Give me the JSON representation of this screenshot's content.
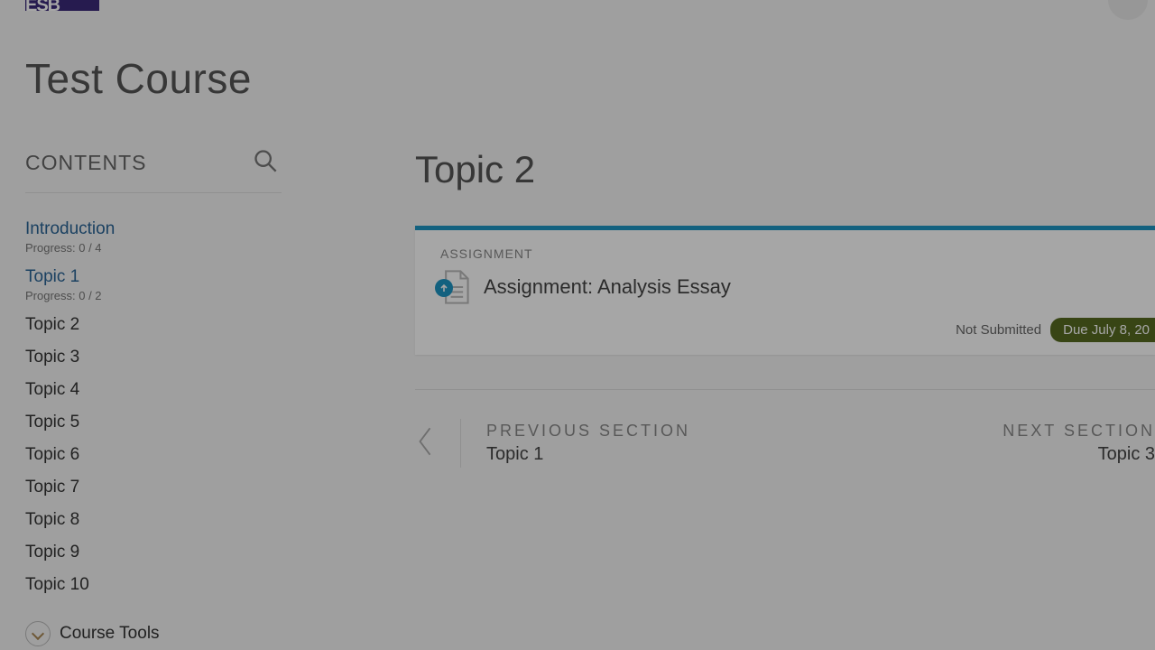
{
  "header": {
    "logo_text": "ESB"
  },
  "course_title": "Test Course",
  "sidebar": {
    "heading": "CONTENTS",
    "items": [
      {
        "label": "Introduction",
        "progress": "Progress: 0 / 4",
        "is_link": true
      },
      {
        "label": "Topic 1",
        "progress": "Progress: 0 / 2",
        "is_link": true
      },
      {
        "label": "Topic 2"
      },
      {
        "label": "Topic 3"
      },
      {
        "label": "Topic 4"
      },
      {
        "label": "Topic 5"
      },
      {
        "label": "Topic 6"
      },
      {
        "label": "Topic 7"
      },
      {
        "label": "Topic 8"
      },
      {
        "label": "Topic 9"
      },
      {
        "label": "Topic 10"
      }
    ],
    "tools_label": "Course Tools"
  },
  "main": {
    "topic_title": "Topic 2",
    "card": {
      "kind": "ASSIGNMENT",
      "title": "Assignment: Analysis Essay",
      "status": "Not Submitted",
      "due": "Due July 8, 20"
    },
    "prev": {
      "heading": "PREVIOUS SECTION",
      "label": "Topic 1"
    },
    "next": {
      "heading": "NEXT SECTION",
      "label": "Topic 3"
    }
  }
}
